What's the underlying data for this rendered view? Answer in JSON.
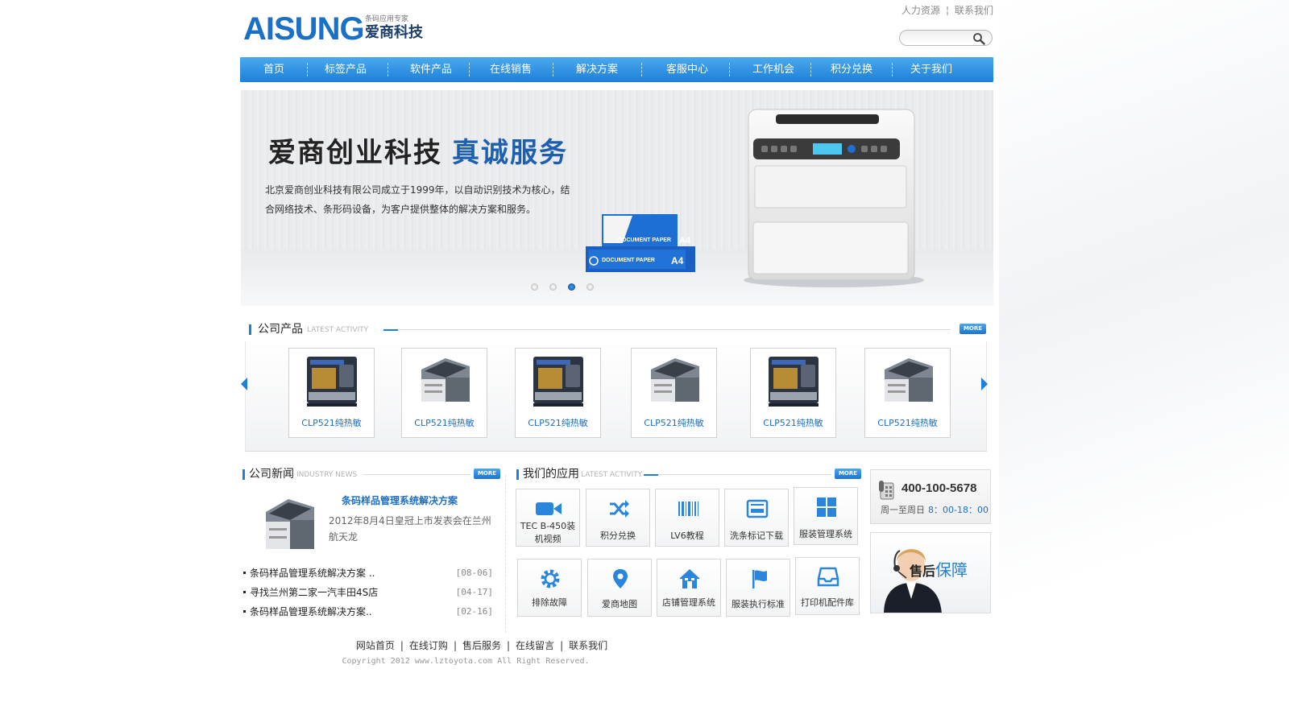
{
  "brand": {
    "logo_text": "AISUNG",
    "tagline": "条码应用专家",
    "name_cn": "爱商科技"
  },
  "top_links": [
    "人力资源",
    "联系我们"
  ],
  "search": {
    "placeholder": ""
  },
  "nav": [
    {
      "label": "首页"
    },
    {
      "label": "标签产品"
    },
    {
      "label": "软件产品"
    },
    {
      "label": "在线销售"
    },
    {
      "label": "解决方案"
    },
    {
      "label": "客服中心"
    },
    {
      "label": "工作机会"
    },
    {
      "label": "积分兑换"
    },
    {
      "label": "关于我们"
    }
  ],
  "banner": {
    "title_black": "爱商创业科技",
    "title_blue": "真诚服务",
    "description": "北京爱商创业科技有限公司成立于1999年，以自动识别技术为核心，结合网络技术、条形码设备，为客户提供整体的解决方案和服务。",
    "paper_text": "DOCUMENT PAPER",
    "paper_size": "A4",
    "slides": 4,
    "active_slide": 3
  },
  "products_section": {
    "title": "公司产品",
    "subtitle": "LATEST ACTIVITY",
    "more": "MORE",
    "items": [
      {
        "label": "CLP521纯热敏",
        "icon": "printer-dark"
      },
      {
        "label": "CLP521纯热敏",
        "icon": "printer-gray"
      },
      {
        "label": "CLP521纯热敏",
        "icon": "printer-dark"
      },
      {
        "label": "CLP521纯热敏",
        "icon": "printer-gray"
      },
      {
        "label": "CLP521纯热敏",
        "icon": "printer-dark"
      },
      {
        "label": "CLP521纯热敏",
        "icon": "printer-gray"
      }
    ]
  },
  "news_section": {
    "title": "公司新闻",
    "subtitle": "INDUSTRY NEWS",
    "more": "MORE",
    "headline": "条码样品管理系统解决方案",
    "summary": "2012年8月4日皇冠上市发表会在兰州航天龙",
    "items": [
      {
        "title": "条码样品管理系统解决方案          ..",
        "date": "[08-06]"
      },
      {
        "title": "寻找兰州第二家一汽丰田4S店",
        "date": "[04-17]"
      },
      {
        "title": "条码样品管理系统解决方案..",
        "date": "[02-16]"
      }
    ]
  },
  "apps_section": {
    "title": "我们的应用",
    "subtitle": "LATEST ACTIVITY",
    "more": "MORE",
    "items": [
      {
        "label": "TEC B-450装机视频",
        "icon": "video-camera-icon"
      },
      {
        "label": "积分兑换",
        "icon": "shuffle-icon"
      },
      {
        "label": "LV6教程",
        "icon": "barcode-icon"
      },
      {
        "label": "洗条标记下载",
        "icon": "card-reader-icon"
      },
      {
        "label": "服装管理系统",
        "icon": "grid-icon"
      },
      {
        "label": "排除故障",
        "icon": "gear-icon"
      },
      {
        "label": "爱商地图",
        "icon": "map-pin-icon"
      },
      {
        "label": "店铺管理系统",
        "icon": "home-icon"
      },
      {
        "label": "服装执行标准",
        "icon": "flag-icon"
      },
      {
        "label": "打印机配件库",
        "icon": "inbox-icon"
      }
    ]
  },
  "contact": {
    "phone": "400-100-5678",
    "hours_label": "周一至周日",
    "hours": "8：00-18：00"
  },
  "service": {
    "title_black": "售后",
    "title_blue": "保障"
  },
  "footer": {
    "links": [
      "网站首页",
      "在线订购",
      "售后服务",
      "在线留言",
      "联系我们"
    ],
    "copyright": "Copyright 2012 www.lztoyota.com All Right Reserved."
  },
  "colors": {
    "accent": "#1e80d8",
    "link": "#1e6fc4"
  }
}
